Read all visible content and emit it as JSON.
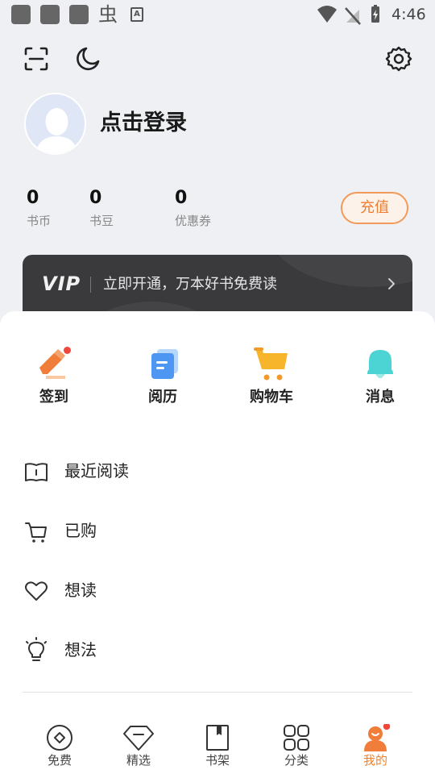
{
  "status_bar": {
    "time": "4:46",
    "app_glyph": "虫",
    "small_glyph": "A"
  },
  "profile": {
    "login_text": "点击登录"
  },
  "stats": [
    {
      "value": "0",
      "label": "书币"
    },
    {
      "value": "0",
      "label": "书豆"
    },
    {
      "value": "0",
      "label": "优惠券"
    }
  ],
  "recharge_label": "充值",
  "vip": {
    "logo": "VIP",
    "text": "立即开通，万本好书免费读"
  },
  "quick_actions": [
    {
      "label": "签到",
      "icon": "sign-in-pencil-icon",
      "badge": true
    },
    {
      "label": "阅历",
      "icon": "history-card-icon"
    },
    {
      "label": "购物车",
      "icon": "shopping-cart-icon"
    },
    {
      "label": "消息",
      "icon": "bell-icon"
    }
  ],
  "menu": [
    {
      "label": "最近阅读",
      "icon": "book-open-icon"
    },
    {
      "label": "已购",
      "icon": "cart-outline-icon"
    },
    {
      "label": "想读",
      "icon": "heart-icon"
    },
    {
      "label": "想法",
      "icon": "lightbulb-icon"
    }
  ],
  "tabs": [
    {
      "label": "免费",
      "icon": "free-diamond-icon"
    },
    {
      "label": "精选",
      "icon": "gem-icon"
    },
    {
      "label": "书架",
      "icon": "bookshelf-icon"
    },
    {
      "label": "分类",
      "icon": "category-grid-icon"
    },
    {
      "label": "我的",
      "icon": "profile-person-icon",
      "active": true,
      "badge": true
    }
  ],
  "colors": {
    "accent": "#f08330",
    "vip_bg": "#3a3a3d",
    "page_bg": "#eef0f3",
    "badge": "#f0463c"
  }
}
